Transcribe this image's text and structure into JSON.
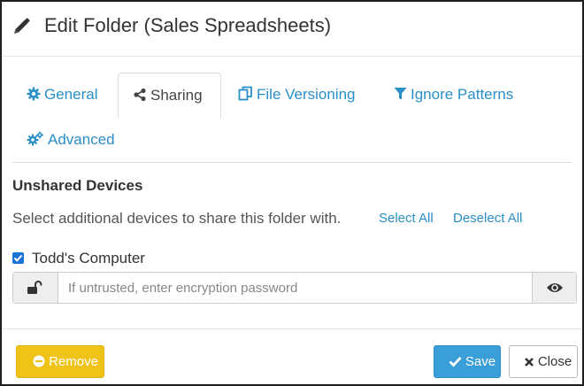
{
  "header": {
    "title": "Edit Folder (Sales Spreadsheets)",
    "icon": "pencil-icon"
  },
  "tabs": [
    {
      "label": "General",
      "icon": "gear-icon",
      "active": false
    },
    {
      "label": "Sharing",
      "icon": "share-icon",
      "active": true
    },
    {
      "label": "File Versioning",
      "icon": "copy-icon",
      "active": false
    },
    {
      "label": "Ignore Patterns",
      "icon": "filter-icon",
      "active": false
    },
    {
      "label": "Advanced",
      "icon": "gears-icon",
      "active": false
    }
  ],
  "sharing": {
    "heading": "Unshared Devices",
    "description": "Select additional devices to share this folder with.",
    "select_all": "Select All",
    "deselect_all": "Deselect All",
    "devices": [
      {
        "name": "Todd's Computer",
        "checked": true,
        "password_placeholder": "If untrusted, enter encryption password",
        "password_value": ""
      }
    ]
  },
  "footer": {
    "remove_label": "Remove",
    "save_label": "Save",
    "close_label": "Close"
  },
  "colors": {
    "link": "#2a8fc6",
    "remove": "#f0c319",
    "save": "#3a9ed8"
  }
}
